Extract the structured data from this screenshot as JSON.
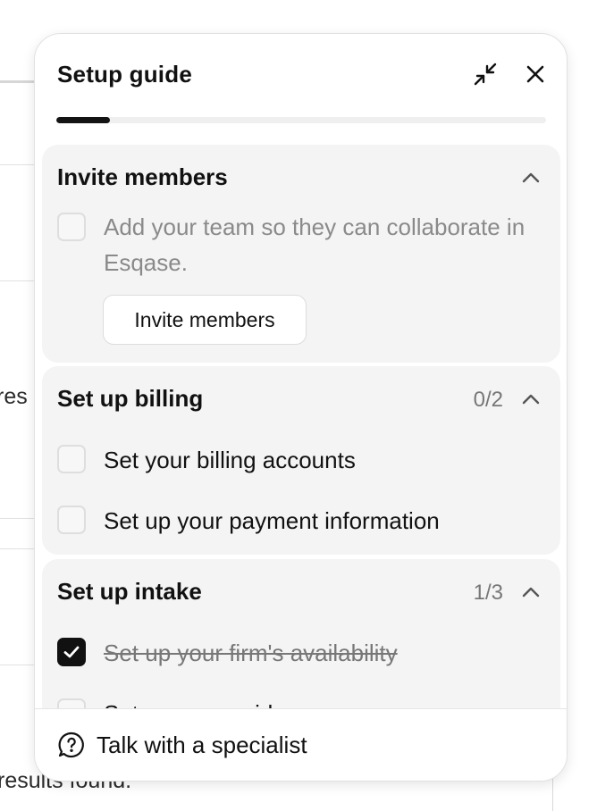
{
  "background": {
    "partial_text_1": "res",
    "partial_text_2": "results found."
  },
  "panel": {
    "title": "Setup guide",
    "minimize_icon": "collapse-arrows-icon",
    "close_icon": "close-icon",
    "progress_fraction": 0.11
  },
  "sections": {
    "invite": {
      "title": "Invite members",
      "expanded": true,
      "task": {
        "description": "Add your team so they can collaborate in Esqase.",
        "checked": false
      },
      "button_label": "Invite members"
    },
    "billing": {
      "title": "Set up billing",
      "count": "0/2",
      "expanded": true,
      "tasks": [
        {
          "label": "Set your billing accounts",
          "checked": false
        },
        {
          "label": "Set up your payment information",
          "checked": false
        }
      ]
    },
    "intake": {
      "title": "Set up intake",
      "count": "1/3",
      "expanded": true,
      "tasks": [
        {
          "label": "Set up your firm's availability",
          "checked": true
        },
        {
          "label": "Set up your guides",
          "checked": false
        }
      ]
    }
  },
  "footer": {
    "label": "Talk with a specialist",
    "icon": "help-circle-icon"
  },
  "colors": {
    "accent": "#111111",
    "section_bg": "#f4f4f4",
    "muted_text": "#8a8a8a"
  }
}
